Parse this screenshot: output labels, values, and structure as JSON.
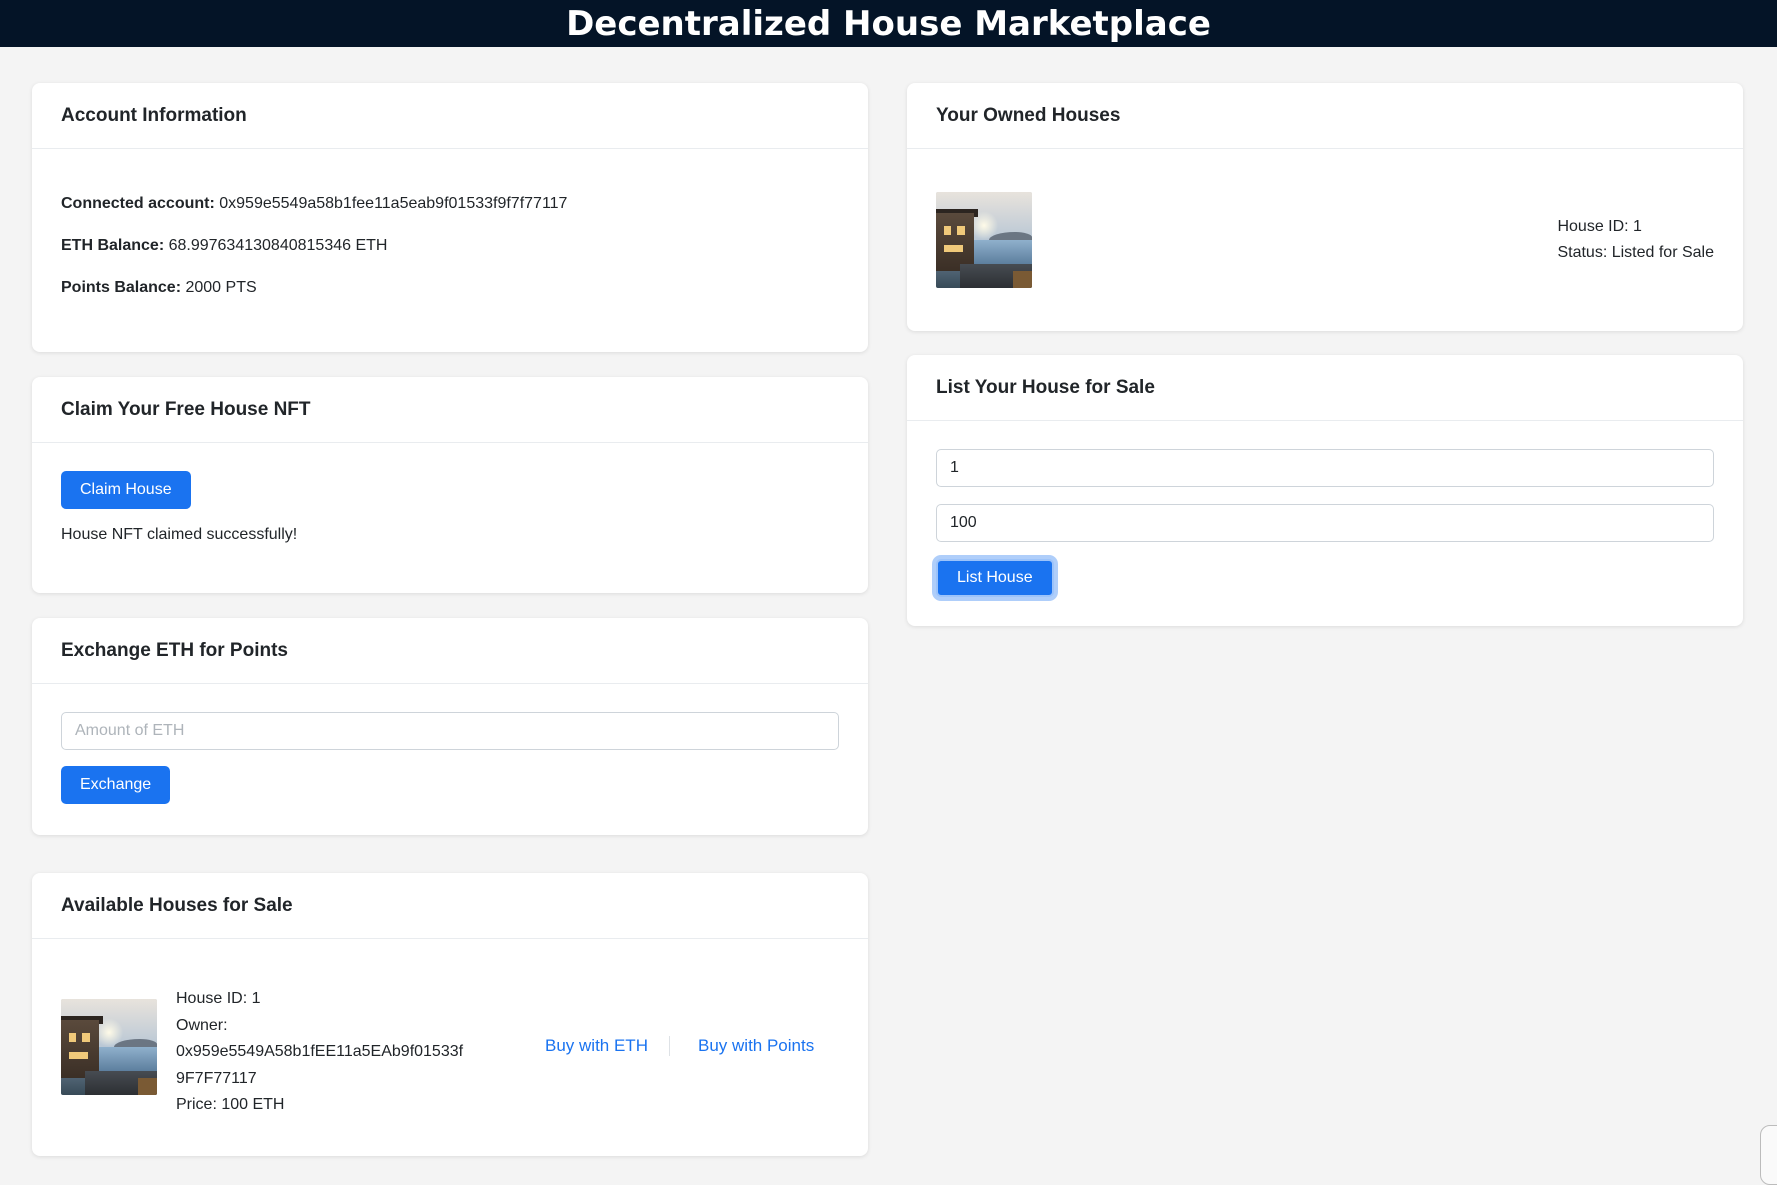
{
  "app": {
    "title": "Decentralized House Marketplace"
  },
  "account": {
    "header": "Account Information",
    "connected_label": "Connected account:",
    "connected_value": "0x959e5549a58b1fee11a5eab9f01533f9f7f77117",
    "eth_label": "ETH Balance:",
    "eth_value": "68.997634130840815346 ETH",
    "points_label": "Points Balance:",
    "points_value": "2000 PTS"
  },
  "claim": {
    "header": "Claim Your Free House NFT",
    "button": "Claim House",
    "message": "House NFT claimed successfully!"
  },
  "exchange": {
    "header": "Exchange ETH for Points",
    "input_placeholder": "Amount of ETH",
    "button": "Exchange"
  },
  "available": {
    "header": "Available Houses for Sale",
    "items": [
      {
        "house_id": "House ID: 1",
        "owner_label": "Owner:",
        "owner_line1": "0x959e5549A58b1fEE11a5EAb9f01533f",
        "owner_line2": "9F7F77117",
        "price": "Price: 100 ETH",
        "buy_eth": "Buy with ETH",
        "buy_points": "Buy with Points"
      }
    ]
  },
  "owned": {
    "header": "Your Owned Houses",
    "items": [
      {
        "house_id": "House ID: 1",
        "status": "Status: Listed for Sale"
      }
    ]
  },
  "list": {
    "header": "List Your House for Sale",
    "house_id_value": "1",
    "price_value": "100",
    "button": "List House"
  },
  "colors": {
    "topbar": "#041427",
    "primary": "#1a73f0",
    "background": "#f4f4f4"
  },
  "icons": {
    "house_image": "house-photo-icon"
  }
}
